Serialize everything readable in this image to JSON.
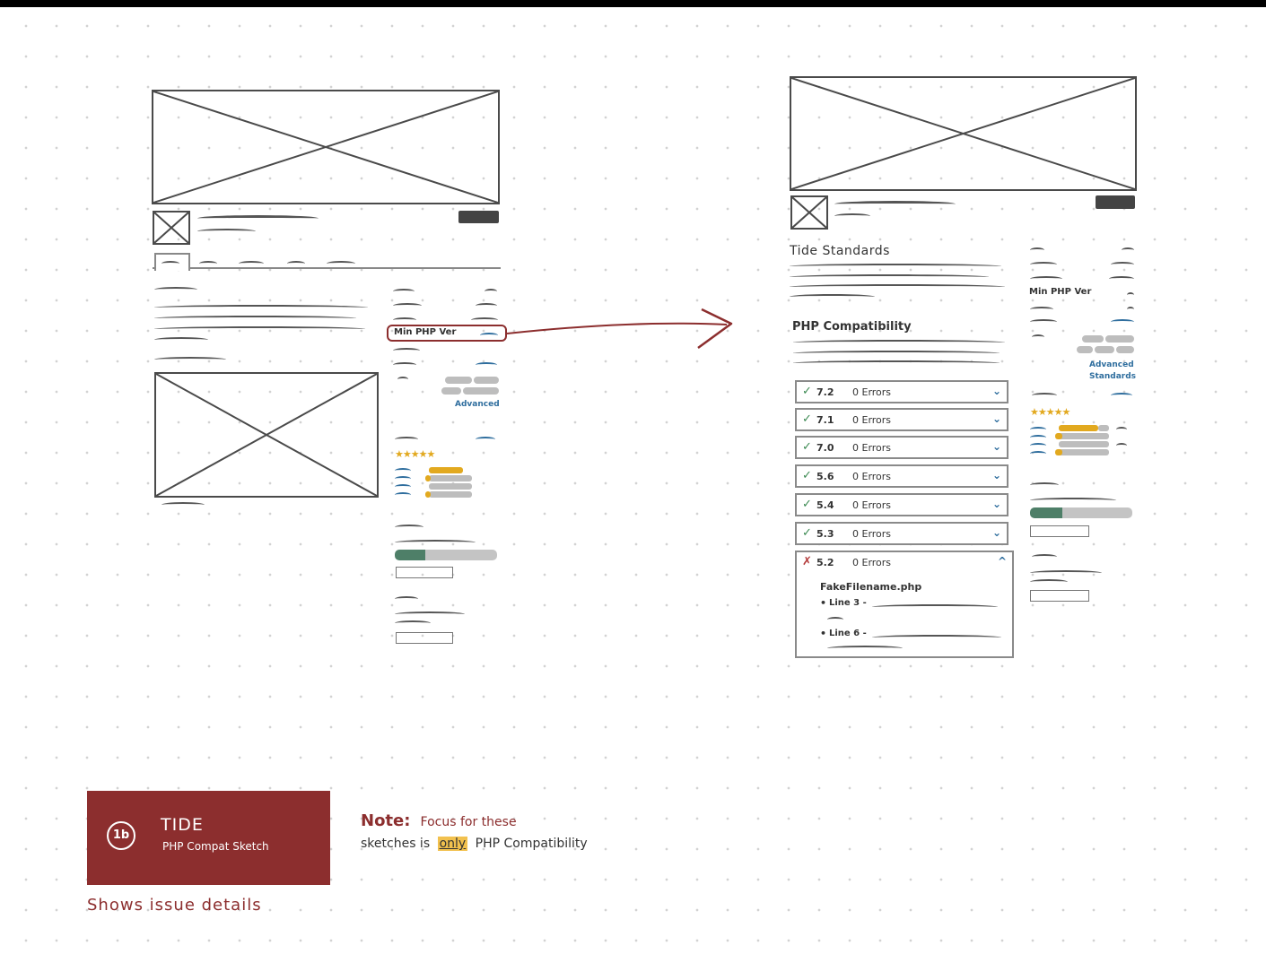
{
  "left_sketch": {
    "sidebar_highlight": "Min PHP Ver",
    "advanced_link": "Advanced"
  },
  "right_sketch": {
    "tide_standards_heading": "Tide Standards",
    "php_compat_heading": "PHP Compatibility",
    "sidebar_min_php": "Min PHP Ver",
    "sidebar_link_1": "Advanced",
    "sidebar_link_2": "Standards",
    "versions": [
      {
        "version": "7.2",
        "errors": "0 Errors",
        "status": "pass",
        "chevron": "⌄"
      },
      {
        "version": "7.1",
        "errors": "0 Errors",
        "status": "pass",
        "chevron": "⌄"
      },
      {
        "version": "7.0",
        "errors": "0 Errors",
        "status": "pass",
        "chevron": "⌄"
      },
      {
        "version": "5.6",
        "errors": "0 Errors",
        "status": "pass",
        "chevron": "⌄"
      },
      {
        "version": "5.4",
        "errors": "0 Errors",
        "status": "pass",
        "chevron": "⌄"
      },
      {
        "version": "5.3",
        "errors": "0 Errors",
        "status": "pass",
        "chevron": "⌄"
      },
      {
        "version": "5.2",
        "errors": "0 Errors",
        "status": "fail",
        "chevron": "^"
      }
    ],
    "issue_file": "FakeFilename.php",
    "issue_lines": [
      "Line 3 -",
      "Line 6 -"
    ]
  },
  "badge": {
    "number": "1b",
    "title": "TIDE",
    "subtitle": "PHP Compat Sketch"
  },
  "caption": "Shows issue details",
  "note": {
    "label": "Note:",
    "text_1": "Focus for these",
    "text_2a": "sketches is",
    "text_2_highlight": "only",
    "text_2b": "PHP Compatibility"
  },
  "colors": {
    "badge": "#8c2e2e",
    "arrow": "#8c2e2e",
    "pass": "#3c8a52",
    "fail": "#b33a3a",
    "link": "#2f6e9e",
    "star": "#e2a91f"
  }
}
